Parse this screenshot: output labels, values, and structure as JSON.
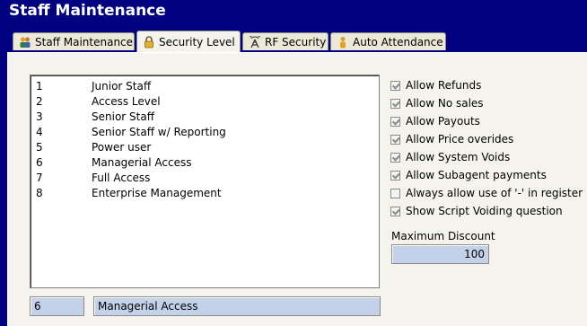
{
  "window": {
    "title": "Staff Maintenance"
  },
  "tabs": [
    {
      "label": "Staff Maintenance",
      "icon": "people-icon",
      "active": false
    },
    {
      "label": "Security Level",
      "icon": "lock-icon",
      "active": true
    },
    {
      "label": "RF Security",
      "icon": "antenna-icon",
      "active": false
    },
    {
      "label": "Auto Attendance",
      "icon": "person-icon",
      "active": false
    }
  ],
  "security_levels": [
    {
      "id": "1",
      "name": "Junior Staff"
    },
    {
      "id": "2",
      "name": "Access Level"
    },
    {
      "id": "3",
      "name": "Senior Staff"
    },
    {
      "id": "4",
      "name": "Senior Staff w/ Reporting"
    },
    {
      "id": "5",
      "name": "Power user"
    },
    {
      "id": "6",
      "name": "Managerial Access"
    },
    {
      "id": "7",
      "name": "Full Access"
    },
    {
      "id": "8",
      "name": "Enterprise Management"
    }
  ],
  "selected": {
    "id": "6",
    "name": "Managerial Access"
  },
  "permissions": [
    {
      "label": "Allow Refunds",
      "checked": true
    },
    {
      "label": "Allow No sales",
      "checked": true
    },
    {
      "label": "Allow Payouts",
      "checked": true
    },
    {
      "label": "Allow Price overides",
      "checked": true
    },
    {
      "label": "Allow System Voids",
      "checked": true
    },
    {
      "label": "Allow Subagent payments",
      "checked": true
    },
    {
      "label": "Always allow use of '-' in register",
      "checked": false
    },
    {
      "label": "Show Script Voiding question",
      "checked": true
    }
  ],
  "max_discount": {
    "label": "Maximum Discount",
    "value": "100"
  },
  "colors": {
    "window_bg": "#000080",
    "panel_bg": "#f4f3ee",
    "field_bg": "#c3d2e8"
  }
}
